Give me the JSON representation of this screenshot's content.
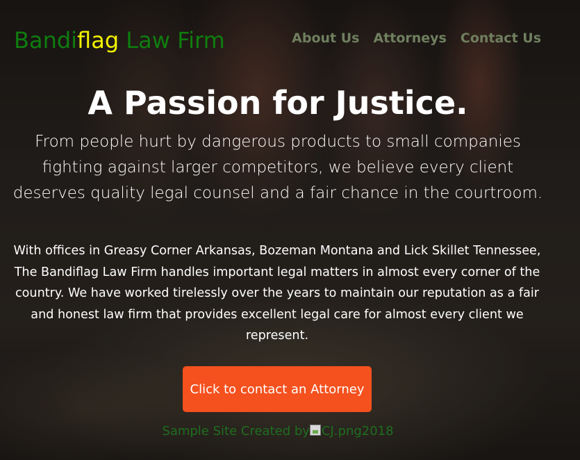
{
  "brand": {
    "part1": "Bandi",
    "part2": "flag",
    "part3": " Law Firm"
  },
  "nav": {
    "items": [
      "About Us",
      "Attorneys",
      "Contact Us"
    ]
  },
  "hero": {
    "title": "A Passion for Justice.",
    "subtitle": "From people hurt by dangerous products to small companies fighting against larger competitors, we believe every client deserves quality legal counsel and a fair chance in the courtroom."
  },
  "intro": {
    "text": "With offices in Greasy Corner Arkansas, Bozeman Montana and Lick Skillet Tennessee, The Bandiflag Law Firm handles important legal matters in almost every corner of the country. We have worked tirelessly over the years to maintain our reputation as a fair and honest law firm that provides excellent legal care for almost every client we represent."
  },
  "cta": {
    "label": "Click to contact an Attorney"
  },
  "footer": {
    "prefix": "Sample Site Created by",
    "image_alt": "CJ.png",
    "year": "2018"
  },
  "colors": {
    "brand_green": "#0f7d0f",
    "brand_yellow": "#f2f200",
    "nav_text": "#6f7f5f",
    "cta_background": "#f4511e",
    "footer_text": "#1f6e1f"
  },
  "icons": {
    "footer_image": "broken-image-icon"
  }
}
